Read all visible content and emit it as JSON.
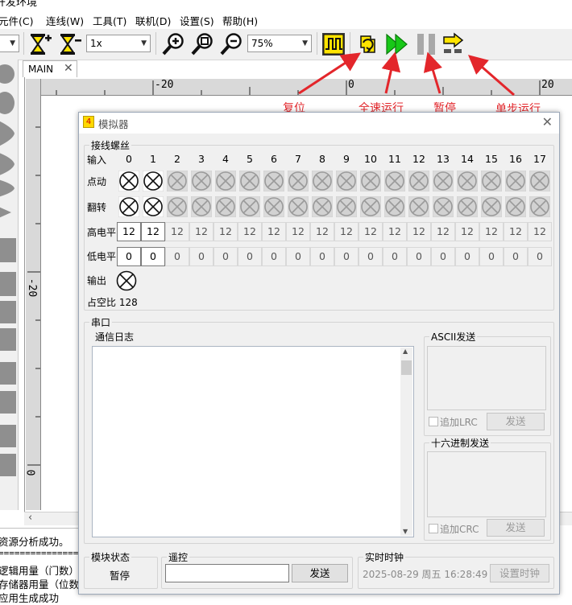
{
  "window": {
    "title": "开发环境"
  },
  "menu": [
    "元件(C)",
    "连线(W)",
    "工具(T)",
    "联机(D)",
    "设置(S)",
    "帮助(H)"
  ],
  "toolbar": {
    "speed": "1x",
    "zoom": "75%"
  },
  "tab": {
    "label": "MAIN"
  },
  "rulers": {
    "h_neg": "-20",
    "h_zero": "0",
    "h_pos": "20",
    "v_neg": "-20",
    "v_zero": "0"
  },
  "annotations": {
    "reset": "复位",
    "run": "全速运行",
    "pause": "暂停",
    "step": "单步运行"
  },
  "colors": {
    "annotation": "#e3262b",
    "run_green": "#18c818",
    "icon_yellow": "#ffe400"
  },
  "output": {
    "lines": [
      "资源分析成功。",
      "================",
      "逻辑用量（门数）:",
      "存储器用量（位数）",
      "应用生成成功"
    ]
  },
  "simulator": {
    "title": "模拟器",
    "title_icon": "4",
    "terminals": {
      "legend": "接线螺丝",
      "input_label": "输入",
      "columns": [
        "0",
        "1",
        "2",
        "3",
        "4",
        "5",
        "6",
        "7",
        "8",
        "9",
        "10",
        "11",
        "12",
        "13",
        "14",
        "15",
        "16",
        "17"
      ],
      "row_labels": {
        "jog": "点动",
        "toggle": "翻转",
        "high": "高电平",
        "low": "低电平",
        "output": "输出"
      },
      "high_values": [
        "12",
        "12",
        "12",
        "12",
        "12",
        "12",
        "12",
        "12",
        "12",
        "12",
        "12",
        "12",
        "12",
        "12",
        "12",
        "12",
        "12",
        "12"
      ],
      "low_values": [
        "0",
        "0",
        "0",
        "0",
        "0",
        "0",
        "0",
        "0",
        "0",
        "0",
        "0",
        "0",
        "0",
        "0",
        "0",
        "0",
        "0",
        "0"
      ],
      "active_columns": 2,
      "duty_label": "占空比",
      "duty_value": "128"
    },
    "serial": {
      "legend": "串口",
      "log_label": "通信日志",
      "ascii_label": "ASCII发送",
      "lrc_label": "追加LRC",
      "send_label": "发送",
      "hex_label": "十六进制发送",
      "crc_label": "追加CRC"
    },
    "module": {
      "legend": "模块状态",
      "status": "暂停"
    },
    "remote": {
      "legend": "遥控",
      "value": "",
      "send_label": "发送"
    },
    "clock": {
      "legend": "实时时钟",
      "datetime": "2025-08-29 周五 16:28:49",
      "set_label": "设置时钟"
    }
  }
}
